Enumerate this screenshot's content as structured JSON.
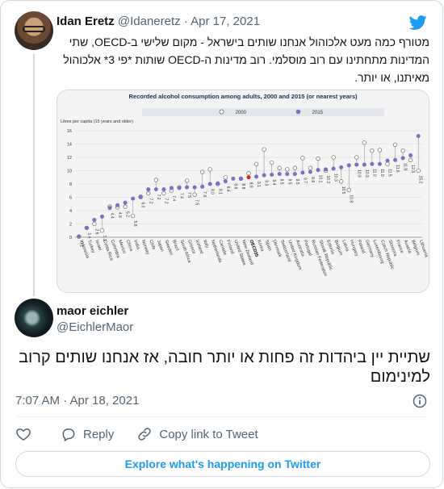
{
  "parent_tweet": {
    "author_name": "Idan Eretz",
    "handle": "@Idaneretz",
    "separator": "·",
    "date": "Apr 17, 2021",
    "text": "מטורף כמה מעט אלכוהול אנחנו שותים בישראל - מקום שלישי ב-OECD, שתי המדינות מתחתינו עם רוב מוסלמי. רוב מדינות ה-OECD שותות *פי 3* אלכוהול מאיתנו, או יותר."
  },
  "reply_tweet": {
    "author_name": "maor eichler",
    "handle": "@EichlerMaor",
    "text": "שתיית יין ביהדות זה פחות או יותר חובה, אז אנחנו שותים קרוב למינימום",
    "time": "7:07 AM · Apr 18, 2021"
  },
  "actions": {
    "reply_label": "Reply",
    "copy_link_label": "Copy link to Tweet"
  },
  "explore_label": "Explore what's happening on Twitter",
  "icons": {
    "brand": "twitter-bird-icon",
    "info": "info-icon",
    "like": "heart-icon",
    "reply": "speech-bubble-icon",
    "copy": "link-icon"
  },
  "colors": {
    "twitter_blue": "#1d9bf0",
    "series_2015": "#7b6fc4",
    "oecd_highlight": "#d62728",
    "text_secondary": "#536471"
  },
  "chart_data": {
    "type": "scatter",
    "title": "Recorded alcohol consumption among adults, 2000 and 2015 (or nearest years)",
    "ylabel": "Litres per capita (15 years and older)",
    "ylim": [
      0,
      16
    ],
    "yticks": [
      0,
      2,
      4,
      6,
      8,
      10,
      12,
      14,
      16
    ],
    "grid": true,
    "legend_position": "top",
    "series": [
      {
        "name": "2000",
        "marker": "hollow-circle"
      },
      {
        "name": "2015",
        "marker": "filled-circle"
      }
    ],
    "categories": [
      "Indonesia",
      "Turkey",
      "Israel",
      "Costa Rica",
      "Colombia",
      "Mexico",
      "China",
      "India",
      "Norway",
      "Chile",
      "Japan",
      "Sweden",
      "Brazil",
      "South Africa",
      "Greece",
      "Iceland",
      "Italy",
      "Netherlands",
      "Canada",
      "Finland",
      "United States",
      "New Zealand",
      "OECD35",
      "Korea",
      "Spain",
      "Denmark",
      "Switzerland",
      "United Kingdom",
      "Australia",
      "Portugal",
      "Russian Federation",
      "Slovak Republic",
      "Estonia",
      "Belgium",
      "Latvia",
      "Hungary",
      "Poland",
      "Germany",
      "Luxembourg",
      "Czech Republic",
      "Slovenia",
      "France",
      "Austria",
      "Belgium",
      "Lithuania"
    ],
    "values_2015": [
      0.1,
      1.4,
      2.6,
      3.1,
      4.4,
      4.8,
      5.2,
      5.8,
      6.0,
      7.2,
      7.2,
      7.2,
      7.4,
      7.4,
      7.5,
      7.5,
      7.6,
      8.0,
      8.1,
      8.4,
      8.8,
      8.8,
      9.0,
      9.1,
      9.3,
      9.4,
      9.5,
      9.5,
      9.5,
      9.7,
      9.8,
      10.1,
      10.2,
      10.3,
      10.5,
      10.8,
      10.9,
      10.9,
      11.0,
      11.0,
      11.5,
      11.6,
      11.9,
      12.3,
      15.2
    ],
    "values_2000": [
      0.1,
      1.4,
      2.0,
      1.0,
      4.6,
      4.5,
      4.6,
      3.2,
      6.1,
      6.6,
      8.6,
      6.6,
      7.0,
      7.5,
      8.5,
      6.4,
      9.8,
      10.2,
      8.0,
      9.0,
      null,
      8.8,
      9.6,
      11.0,
      13.2,
      11.2,
      10.4,
      10.2,
      10.4,
      11.9,
      10.4,
      11.8,
      10.0,
      12.0,
      8.4,
      7.1,
      12.0,
      14.2,
      13.0,
      13.1,
      11.0,
      13.9,
      13.0,
      11.6,
      10.0
    ],
    "value_labels_2015": [
      "0.1",
      "1.4",
      "2.6",
      "3.1",
      "4.4",
      "4.8",
      "5.2",
      "5.8",
      "6.0",
      "7.2",
      "7.2",
      "7.2",
      "7.4",
      "7.4",
      "7.5",
      "7.5",
      "7.6",
      "8.0",
      "8.1",
      "8.4",
      "8.8",
      "8.8",
      "8.8",
      "9.1",
      "9.3",
      "9.4",
      "9.5",
      "9.5",
      "9.5",
      "9.7",
      "9.8",
      "10.1",
      "10.2",
      "10.3",
      "10.5",
      "10.8",
      "10.9",
      "10.9",
      "11.0",
      "11.0",
      "11.5",
      "11.6",
      "11.9",
      "12.3",
      "15.2"
    ]
  }
}
